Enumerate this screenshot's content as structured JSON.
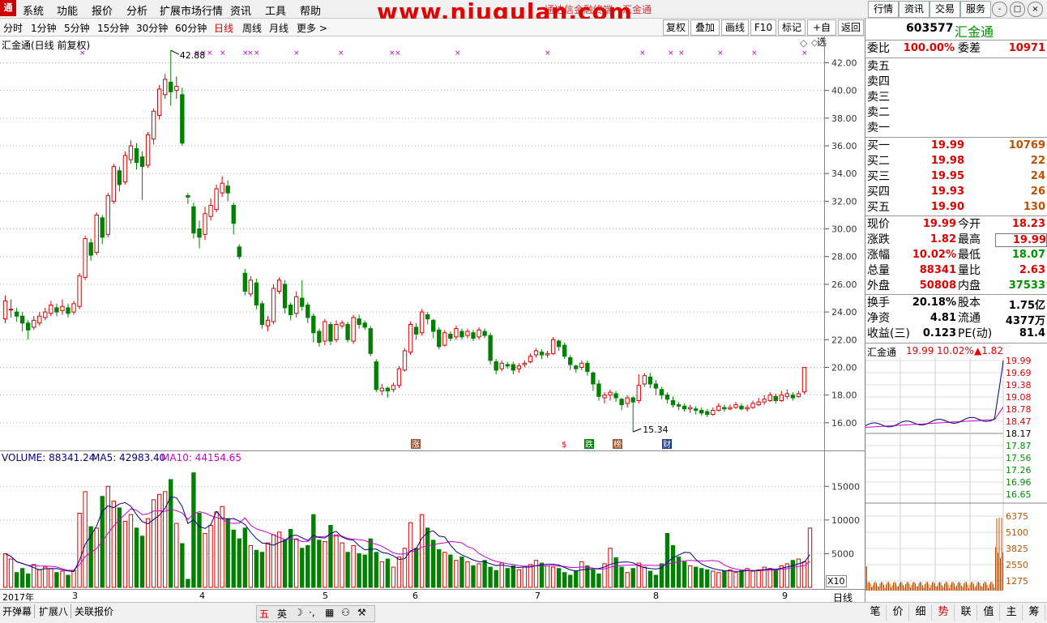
{
  "menu": {
    "logo": "通",
    "items": [
      "系统",
      "功能",
      "报价",
      "分析",
      "扩展市场行情",
      "资讯",
      "工具",
      "帮助"
    ],
    "watermark": "www.niugulan.com",
    "window_title": "通达信金融终端　汇金通",
    "right_buttons": [
      "行情",
      "资讯",
      "交易",
      "服务"
    ],
    "window_controls": [
      "-",
      "□",
      "×"
    ]
  },
  "periods": {
    "items": [
      "分时",
      "1分钟",
      "5分钟",
      "15分钟",
      "30分钟",
      "60分钟",
      "日线",
      "周线",
      "月线",
      "更多 >"
    ],
    "active_index": 6,
    "tools": [
      "复权",
      "叠加",
      "画线",
      "F10",
      "标记",
      "+自选",
      "返回"
    ]
  },
  "chart_header": {
    "title": "汇金通(日线 前复权)",
    "high_label": "42.88",
    "low_label": "15.34"
  },
  "price_axis": {
    "ticks": [
      "42.00",
      "40.00",
      "38.00",
      "36.00",
      "34.00",
      "32.00",
      "30.00",
      "28.00",
      "26.00",
      "24.00",
      "22.00",
      "20.00",
      "18.00",
      "16.00"
    ]
  },
  "vol_axis": {
    "ticks": [
      "15000",
      "10000",
      "5000"
    ],
    "multiplier": "X10"
  },
  "volume_header": {
    "volume": "VOLUME: 88341.24",
    "ma5": "MA5: 42983.40",
    "ma10": "MA10: 44154.65"
  },
  "markers": [
    "涨",
    "$",
    "跌",
    "榜",
    "财"
  ],
  "colors": {
    "up": "#e00000",
    "down": "#008000",
    "ma5": "#000080",
    "ma10": "#cc00cc",
    "volume_up": "#e00000",
    "volume_down": "#008000"
  },
  "date_axis": {
    "labels": [
      "2017年",
      "3",
      "4",
      "5",
      "6",
      "7",
      "8",
      "9"
    ],
    "period_label": "日线"
  },
  "bottom_tabs": [
    "开弹幕",
    "扩展八",
    "关联报价"
  ],
  "ime_bar": [
    "五",
    "英",
    "☽",
    "·,",
    "▦",
    "⚇",
    "⚒"
  ],
  "side": {
    "code": "603577",
    "name": "汇金通",
    "weibi_label": "委比",
    "weibi": "100.00%",
    "weicha_label": "委差",
    "weicha": "10971",
    "sell": [
      {
        "label": "卖五",
        "price": "",
        "vol": ""
      },
      {
        "label": "卖四",
        "price": "",
        "vol": ""
      },
      {
        "label": "卖三",
        "price": "",
        "vol": ""
      },
      {
        "label": "卖二",
        "price": "",
        "vol": ""
      },
      {
        "label": "卖一",
        "price": "",
        "vol": ""
      }
    ],
    "buy": [
      {
        "label": "买一",
        "price": "19.99",
        "vol": "10769"
      },
      {
        "label": "买二",
        "price": "19.98",
        "vol": "22"
      },
      {
        "label": "买三",
        "price": "19.95",
        "vol": "24"
      },
      {
        "label": "买四",
        "price": "19.93",
        "vol": "26"
      },
      {
        "label": "买五",
        "price": "19.90",
        "vol": "130"
      }
    ],
    "stats": [
      {
        "l1": "现价",
        "v1": "19.99",
        "c1": "red",
        "l2": "今开",
        "v2": "18.23",
        "c2": "red"
      },
      {
        "l1": "涨跌",
        "v1": "1.82",
        "c1": "red",
        "l2": "最高",
        "v2": "19.99",
        "c2": "red"
      },
      {
        "l1": "涨幅",
        "v1": "10.02%",
        "c1": "red",
        "l2": "最低",
        "v2": "18.07",
        "c2": "green"
      },
      {
        "l1": "总量",
        "v1": "88341",
        "c1": "red",
        "l2": "量比",
        "v2": "2.63",
        "c2": "red"
      },
      {
        "l1": "外盘",
        "v1": "50808",
        "c1": "red",
        "l2": "内盘",
        "v2": "37533",
        "c2": "green"
      }
    ],
    "fund": [
      {
        "l1": "换手",
        "v1": "20.18%",
        "l2": "股本",
        "v2": "1.75亿"
      },
      {
        "l1": "净资",
        "v1": "4.81",
        "l2": "流通",
        "v2": "4377万"
      },
      {
        "l1": "收益(三)",
        "v1": "0.123",
        "l2": "PE(动)",
        "v2": "81.4"
      }
    ],
    "mini_header": {
      "name": "汇金通",
      "price": "19.99",
      "pct": "10.02%",
      "chg": "▲1.82"
    },
    "mini_price_ticks": [
      "19.99",
      "19.69",
      "19.38",
      "19.08",
      "18.78",
      "18.47",
      "18.17",
      "17.87",
      "17.56",
      "17.26",
      "16.96",
      "16.65"
    ],
    "mini_vol_ticks": [
      "6375",
      "5100",
      "3825",
      "2550",
      "1275"
    ],
    "tabs": [
      "笔",
      "价",
      "细",
      "势",
      "联",
      "值",
      "主",
      "筹"
    ],
    "active_tab": 3
  },
  "chart_data": {
    "type": "candlestick",
    "title": "汇金通(日线 前复权)",
    "period": "daily",
    "ylim": [
      15,
      43
    ],
    "annotations": [
      {
        "text": "42.88",
        "kind": "high"
      },
      {
        "text": "15.34",
        "kind": "low"
      }
    ],
    "candles": [
      [
        23.5,
        24.8,
        23.2,
        25.2
      ],
      [
        24.2,
        24.2,
        23.6,
        24.9
      ],
      [
        24.0,
        23.7,
        23.3,
        24.3
      ],
      [
        23.7,
        23.2,
        22.6,
        24.0
      ],
      [
        23.2,
        22.7,
        22.0,
        23.4
      ],
      [
        22.9,
        23.4,
        22.7,
        23.7
      ],
      [
        23.2,
        23.7,
        23.0,
        24.0
      ],
      [
        23.6,
        24.0,
        23.4,
        24.3
      ],
      [
        23.9,
        24.5,
        23.7,
        24.8
      ],
      [
        24.3,
        24.0,
        23.7,
        24.6
      ],
      [
        24.1,
        24.4,
        23.8,
        24.9
      ],
      [
        24.3,
        23.9,
        23.6,
        24.6
      ],
      [
        24.0,
        24.6,
        23.8,
        24.8
      ],
      [
        24.4,
        26.6,
        24.2,
        26.8
      ],
      [
        26.5,
        29.3,
        26.3,
        29.5
      ],
      [
        29.0,
        28.1,
        27.7,
        29.3
      ],
      [
        28.3,
        31.0,
        28.1,
        31.2
      ],
      [
        30.8,
        29.4,
        28.9,
        31.0
      ],
      [
        29.6,
        32.4,
        29.4,
        32.6
      ],
      [
        32.0,
        34.5,
        31.8,
        34.7
      ],
      [
        34.2,
        33.2,
        32.7,
        34.5
      ],
      [
        33.4,
        35.3,
        33.2,
        35.6
      ],
      [
        35.0,
        36.0,
        34.7,
        36.4
      ],
      [
        35.8,
        34.8,
        34.3,
        36.2
      ],
      [
        35.2,
        34.5,
        32.1,
        35.6
      ],
      [
        34.6,
        36.8,
        34.4,
        37.0
      ],
      [
        36.5,
        38.5,
        36.1,
        38.7
      ],
      [
        38.2,
        40.1,
        37.9,
        40.4
      ],
      [
        39.7,
        40.8,
        39.4,
        41.2
      ],
      [
        40.6,
        39.9,
        38.9,
        42.9
      ],
      [
        40.0,
        40.3,
        39.4,
        41.0
      ],
      [
        39.7,
        36.2,
        36.0,
        40.2
      ],
      [
        32.4,
        32.3,
        31.8,
        32.6
      ],
      [
        31.6,
        29.7,
        29.3,
        31.9
      ],
      [
        30.0,
        29.4,
        28.6,
        30.6
      ],
      [
        29.6,
        31.1,
        29.2,
        31.6
      ],
      [
        30.9,
        31.7,
        30.6,
        32.2
      ],
      [
        31.4,
        32.9,
        31.2,
        33.2
      ],
      [
        32.6,
        33.3,
        32.3,
        33.8
      ],
      [
        33.1,
        32.6,
        32.0,
        33.5
      ],
      [
        31.7,
        30.4,
        29.6,
        31.9
      ],
      [
        28.7,
        28.0,
        27.8,
        28.9
      ],
      [
        26.8,
        25.5,
        25.2,
        27.1
      ],
      [
        25.3,
        26.3,
        25.1,
        26.6
      ],
      [
        26.1,
        24.5,
        24.2,
        26.4
      ],
      [
        24.6,
        23.1,
        22.8,
        24.8
      ],
      [
        23.0,
        23.4,
        22.6,
        23.7
      ],
      [
        23.3,
        25.7,
        23.1,
        26.0
      ],
      [
        25.5,
        26.3,
        25.3,
        26.5
      ],
      [
        26.0,
        24.3,
        23.9,
        26.3
      ],
      [
        24.5,
        23.8,
        23.4,
        24.7
      ],
      [
        23.9,
        25.1,
        23.6,
        25.5
      ],
      [
        25.0,
        24.4,
        24.1,
        26.3
      ],
      [
        24.5,
        23.6,
        23.2,
        24.7
      ],
      [
        23.7,
        22.5,
        21.8,
        23.9
      ],
      [
        22.6,
        21.8,
        21.5,
        22.8
      ],
      [
        21.9,
        23.3,
        21.6,
        23.5
      ],
      [
        23.1,
        21.9,
        21.6,
        23.3
      ],
      [
        22.0,
        23.1,
        21.8,
        23.4
      ],
      [
        23.0,
        23.2,
        22.8,
        23.4
      ],
      [
        23.1,
        22.0,
        21.8,
        23.3
      ],
      [
        21.9,
        23.6,
        21.7,
        23.8
      ],
      [
        23.5,
        23.1,
        22.8,
        23.8
      ],
      [
        23.2,
        22.9,
        22.7,
        23.4
      ],
      [
        22.8,
        21.0,
        20.8,
        23.0
      ],
      [
        20.4,
        18.4,
        18.2,
        20.6
      ],
      [
        18.3,
        18.5,
        18.0,
        18.8
      ],
      [
        18.5,
        18.3,
        17.8,
        18.6
      ],
      [
        18.4,
        18.7,
        18.2,
        18.9
      ],
      [
        18.7,
        19.9,
        18.5,
        20.1
      ],
      [
        19.8,
        21.2,
        19.7,
        21.4
      ],
      [
        21.1,
        23.1,
        20.9,
        23.3
      ],
      [
        22.9,
        22.4,
        22.0,
        23.2
      ],
      [
        22.5,
        24.0,
        22.3,
        24.2
      ],
      [
        23.8,
        23.5,
        23.1,
        24.0
      ],
      [
        23.4,
        22.6,
        22.1,
        23.5
      ],
      [
        22.7,
        21.5,
        21.3,
        22.9
      ],
      [
        21.6,
        22.5,
        21.5,
        22.7
      ],
      [
        22.4,
        22.1,
        21.9,
        22.6
      ],
      [
        22.2,
        22.8,
        22.0,
        23.0
      ],
      [
        22.6,
        22.2,
        22.0,
        22.8
      ],
      [
        22.3,
        22.6,
        22.1,
        22.8
      ],
      [
        22.5,
        22.1,
        21.9,
        22.7
      ],
      [
        22.2,
        22.7,
        22.0,
        22.9
      ],
      [
        22.6,
        22.3,
        22.1,
        22.8
      ],
      [
        22.3,
        20.5,
        20.2,
        22.5
      ],
      [
        20.4,
        19.8,
        19.5,
        20.6
      ],
      [
        19.9,
        20.3,
        19.7,
        20.5
      ],
      [
        20.2,
        20.1,
        19.9,
        20.4
      ],
      [
        20.2,
        19.8,
        19.5,
        20.4
      ],
      [
        19.9,
        20.1,
        19.6,
        20.3
      ],
      [
        20.2,
        20.3,
        20.0,
        20.5
      ],
      [
        20.4,
        20.8,
        20.3,
        21.0
      ],
      [
        20.9,
        21.2,
        20.7,
        21.4
      ],
      [
        21.1,
        20.9,
        20.6,
        21.3
      ],
      [
        20.9,
        21.0,
        20.7,
        21.2
      ],
      [
        21.0,
        22.0,
        20.9,
        22.2
      ],
      [
        21.9,
        21.5,
        21.2,
        22.0
      ],
      [
        21.6,
        20.8,
        20.6,
        21.8
      ],
      [
        20.7,
        20.2,
        19.8,
        20.9
      ],
      [
        20.1,
        19.9,
        19.6,
        20.2
      ],
      [
        20.0,
        20.3,
        19.8,
        20.5
      ],
      [
        20.3,
        19.7,
        19.4,
        20.5
      ],
      [
        19.6,
        18.8,
        18.3,
        19.7
      ],
      [
        18.8,
        17.9,
        17.6,
        19.1
      ],
      [
        17.8,
        18.0,
        17.4,
        18.2
      ],
      [
        18.0,
        18.2,
        17.6,
        18.4
      ],
      [
        18.1,
        17.8,
        17.5,
        18.3
      ],
      [
        17.7,
        17.3,
        16.9,
        17.8
      ],
      [
        17.4,
        17.8,
        17.1,
        18.0
      ],
      [
        17.8,
        17.5,
        15.34,
        17.9
      ],
      [
        17.6,
        18.7,
        17.4,
        19.5
      ],
      [
        18.8,
        19.4,
        18.6,
        19.6
      ],
      [
        19.3,
        18.8,
        18.5,
        19.6
      ],
      [
        18.8,
        18.5,
        18.0,
        19.1
      ],
      [
        18.4,
        18.0,
        17.7,
        18.6
      ],
      [
        18.0,
        17.7,
        17.4,
        18.2
      ],
      [
        17.6,
        17.3,
        17.1,
        17.9
      ],
      [
        17.3,
        17.2,
        16.9,
        17.5
      ],
      [
        17.2,
        17.0,
        16.8,
        17.4
      ],
      [
        17.0,
        17.1,
        16.7,
        17.3
      ],
      [
        17.0,
        16.9,
        16.6,
        17.2
      ],
      [
        16.9,
        16.7,
        16.5,
        17.1
      ],
      [
        16.8,
        16.6,
        16.4,
        17.0
      ],
      [
        16.6,
        16.9,
        16.5,
        17.1
      ],
      [
        16.9,
        17.2,
        16.8,
        17.4
      ],
      [
        17.1,
        17.0,
        16.8,
        17.3
      ],
      [
        17.0,
        17.1,
        16.9,
        17.3
      ],
      [
        17.1,
        17.3,
        17.0,
        17.5
      ],
      [
        17.2,
        17.0,
        16.9,
        17.4
      ],
      [
        17.0,
        17.1,
        16.8,
        17.3
      ],
      [
        17.1,
        17.4,
        17.0,
        17.6
      ],
      [
        17.3,
        17.5,
        17.2,
        17.8
      ],
      [
        17.5,
        17.7,
        17.3,
        18.0
      ],
      [
        17.6,
        18.0,
        17.5,
        18.2
      ],
      [
        17.9,
        17.6,
        17.4,
        18.1
      ],
      [
        17.6,
        18.0,
        17.5,
        18.3
      ],
      [
        17.9,
        18.1,
        17.7,
        18.4
      ],
      [
        18.0,
        17.8,
        17.6,
        18.2
      ],
      [
        17.9,
        18.1,
        17.8,
        18.3
      ],
      [
        18.23,
        19.99,
        18.07,
        19.99
      ]
    ],
    "volume": [
      50,
      42,
      22,
      28,
      20,
      34,
      26,
      30,
      28,
      22,
      24,
      18,
      25,
      110,
      142,
      90,
      88,
      135,
      150,
      128,
      118,
      98,
      108,
      88,
      76,
      102,
      130,
      138,
      142,
      160,
      95,
      65,
      12,
      170,
      110,
      80,
      92,
      112,
      120,
      102,
      85,
      72,
      88,
      62,
      55,
      52,
      66,
      78,
      82,
      70,
      86,
      72,
      58,
      62,
      108,
      70,
      68,
      92,
      78,
      66,
      52,
      62,
      50,
      48,
      72,
      52,
      38,
      42,
      30,
      45,
      58,
      96,
      58,
      108,
      88,
      70,
      56,
      52,
      48,
      40,
      45,
      38,
      32,
      35,
      40,
      30,
      25,
      36,
      28,
      32,
      26,
      30,
      34,
      40,
      36,
      32,
      30,
      28,
      22,
      18,
      24,
      38,
      32,
      26,
      20,
      35,
      58,
      44,
      30,
      22,
      28,
      36,
      30,
      24,
      18,
      35,
      80,
      62,
      45,
      38,
      32,
      30,
      28,
      26,
      24,
      22,
      24,
      26,
      22,
      25,
      28,
      24,
      26,
      30,
      28,
      26,
      32,
      35,
      40,
      42,
      38,
      88
    ],
    "ma5": [
      42983.4
    ],
    "ma10": [
      44154.65
    ]
  }
}
